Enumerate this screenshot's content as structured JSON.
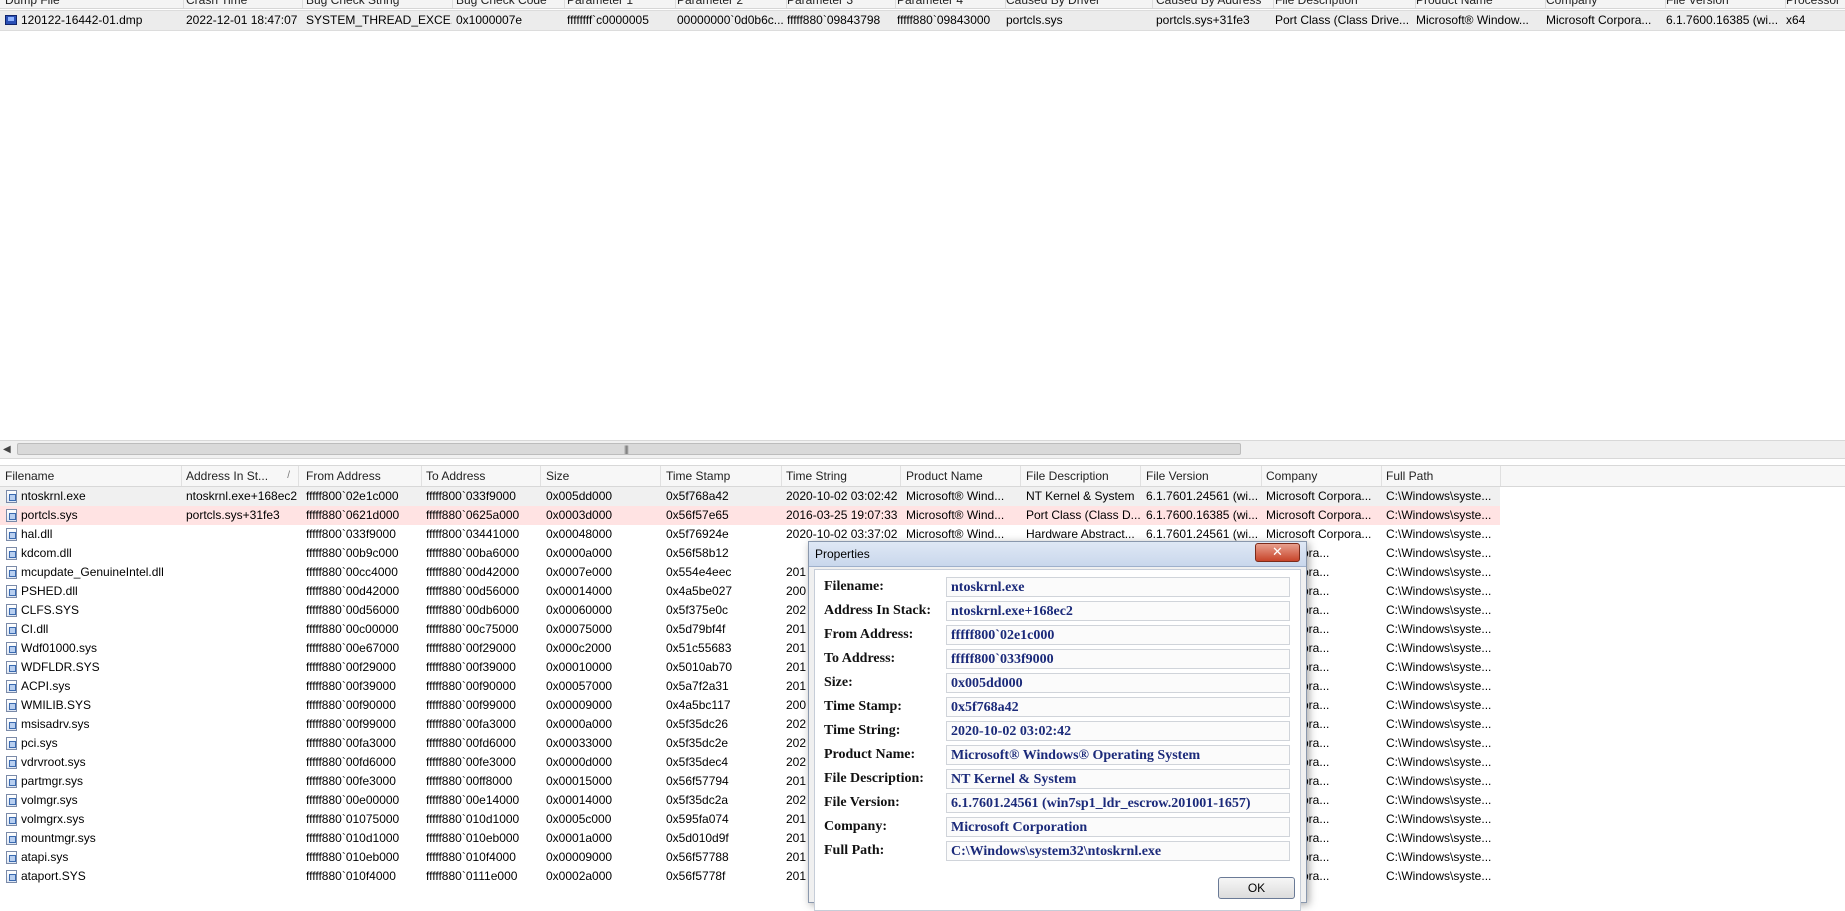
{
  "top_table": {
    "headers": [
      "Dump File",
      "Crash Time",
      "Bug Check String",
      "Bug Check Code",
      "Parameter 1",
      "Parameter 2",
      "Parameter 3",
      "Parameter 4",
      "Caused By Driver",
      "Caused By Address",
      "File Description",
      "Product Name",
      "Company",
      "File Version",
      "Processor"
    ],
    "row": [
      "120122-16442-01.dmp",
      "2022-12-01 18:47:07",
      "SYSTEM_THREAD_EXCE...",
      "0x1000007e",
      "ffffffff`c0000005",
      "00000000`0d0b6c...",
      "fffff880`09843798",
      "fffff880`09843000",
      "portcls.sys",
      "portcls.sys+31fe3",
      "Port Class (Class Drive...",
      "Microsoft® Window...",
      "Microsoft Corpora...",
      "6.1.7600.16385 (wi...",
      "x64"
    ]
  },
  "scrollbar": {
    "grip": "|||"
  },
  "lower_table": {
    "headers": [
      "Filename",
      "Address In St...",
      "From Address",
      "To Address",
      "Size",
      "Time Stamp",
      "Time String",
      "Product Name",
      "File Description",
      "File Version",
      "Company",
      "Full Path"
    ],
    "sort_indicator": "/",
    "rows": [
      [
        "ntoskrnl.exe",
        "ntoskrnl.exe+168ec2",
        "fffff800`02e1c000",
        "fffff800`033f9000",
        "0x005dd000",
        "0x5f768a42",
        "2020-10-02 03:02:42",
        "Microsoft® Wind...",
        "NT Kernel & System",
        "6.1.7601.24561 (wi...",
        "Microsoft Corpora...",
        "C:\\Windows\\syste..."
      ],
      [
        "portcls.sys",
        "portcls.sys+31fe3",
        "fffff880`0621d000",
        "fffff880`0625a000",
        "0x0003d000",
        "0x56f57e65",
        "2016-03-25 19:07:33",
        "Microsoft® Wind...",
        "Port Class (Class D...",
        "6.1.7600.16385 (wi...",
        "Microsoft Corpora...",
        "C:\\Windows\\syste..."
      ],
      [
        "hal.dll",
        "",
        "fffff800`033f9000",
        "fffff800`03441000",
        "0x00048000",
        "0x5f76924e",
        "2020-10-02 03:37:02",
        "Microsoft® Wind...",
        "Hardware Abstract...",
        "6.1.7601.24561 (wi...",
        "Microsoft Corpora...",
        "C:\\Windows\\syste..."
      ],
      [
        "kdcom.dll",
        "",
        "fffff880`00b9c000",
        "fffff880`00ba6000",
        "0x0000a000",
        "0x56f58b12",
        "",
        "",
        "",
        "",
        "ft Corpora...",
        "C:\\Windows\\syste..."
      ],
      [
        "mcupdate_GenuineIntel.dll",
        "",
        "fffff880`00cc4000",
        "fffff880`00d42000",
        "0x0007e000",
        "0x554e4eec",
        "201",
        "",
        "",
        "",
        "ft Corpora...",
        "C:\\Windows\\syste..."
      ],
      [
        "PSHED.dll",
        "",
        "fffff880`00d42000",
        "fffff880`00d56000",
        "0x00014000",
        "0x4a5be027",
        "200",
        "",
        "",
        "",
        "ft Corpora...",
        "C:\\Windows\\syste..."
      ],
      [
        "CLFS.SYS",
        "",
        "fffff880`00d56000",
        "fffff880`00db6000",
        "0x00060000",
        "0x5f375e0c",
        "202",
        "",
        "",
        "",
        "ft Corpora...",
        "C:\\Windows\\syste..."
      ],
      [
        "CI.dll",
        "",
        "fffff880`00c00000",
        "fffff880`00c75000",
        "0x00075000",
        "0x5d79bf4f",
        "201",
        "",
        "",
        "",
        "ft Corpora...",
        "C:\\Windows\\syste..."
      ],
      [
        "Wdf01000.sys",
        "",
        "fffff880`00e67000",
        "fffff880`00f29000",
        "0x000c2000",
        "0x51c55683",
        "201",
        "",
        "",
        "",
        "ft Corpora...",
        "C:\\Windows\\syste..."
      ],
      [
        "WDFLDR.SYS",
        "",
        "fffff880`00f29000",
        "fffff880`00f39000",
        "0x00010000",
        "0x5010ab70",
        "201",
        "",
        "",
        "",
        "ft Corpora...",
        "C:\\Windows\\syste..."
      ],
      [
        "ACPI.sys",
        "",
        "fffff880`00f39000",
        "fffff880`00f90000",
        "0x00057000",
        "0x5a7f2a31",
        "201",
        "",
        "",
        "",
        "ft Corpora...",
        "C:\\Windows\\syste..."
      ],
      [
        "WMILIB.SYS",
        "",
        "fffff880`00f90000",
        "fffff880`00f99000",
        "0x00009000",
        "0x4a5bc117",
        "200",
        "",
        "",
        "",
        "ft Corpora...",
        "C:\\Windows\\syste..."
      ],
      [
        "msisadrv.sys",
        "",
        "fffff880`00f99000",
        "fffff880`00fa3000",
        "0x0000a000",
        "0x5f35dc26",
        "202",
        "",
        "",
        "",
        "ft Corpora...",
        "C:\\Windows\\syste..."
      ],
      [
        "pci.sys",
        "",
        "fffff880`00fa3000",
        "fffff880`00fd6000",
        "0x00033000",
        "0x5f35dc2e",
        "202",
        "",
        "",
        "",
        "ft Corpora...",
        "C:\\Windows\\syste..."
      ],
      [
        "vdrvroot.sys",
        "",
        "fffff880`00fd6000",
        "fffff880`00fe3000",
        "0x0000d000",
        "0x5f35dec4",
        "202",
        "",
        "",
        "",
        "ft Corpora...",
        "C:\\Windows\\syste..."
      ],
      [
        "partmgr.sys",
        "",
        "fffff880`00fe3000",
        "fffff880`00ff8000",
        "0x00015000",
        "0x56f57794",
        "201",
        "",
        "",
        "",
        "ft Corpora...",
        "C:\\Windows\\syste..."
      ],
      [
        "volmgr.sys",
        "",
        "fffff880`00e00000",
        "fffff880`00e14000",
        "0x00014000",
        "0x5f35dc2a",
        "202",
        "",
        "",
        "",
        "ft Corpora...",
        "C:\\Windows\\syste..."
      ],
      [
        "volmgrx.sys",
        "",
        "fffff880`01075000",
        "fffff880`010d1000",
        "0x0005c000",
        "0x595fa074",
        "201",
        "",
        "",
        "",
        "ft Corpora...",
        "C:\\Windows\\syste..."
      ],
      [
        "mountmgr.sys",
        "",
        "fffff880`010d1000",
        "fffff880`010eb000",
        "0x0001a000",
        "0x5d010d9f",
        "201",
        "",
        "",
        "",
        "ft Corpora...",
        "C:\\Windows\\syste..."
      ],
      [
        "atapi.sys",
        "",
        "fffff880`010eb000",
        "fffff880`010f4000",
        "0x00009000",
        "0x56f57788",
        "201",
        "",
        "",
        "",
        "ft Corpora...",
        "C:\\Windows\\syste..."
      ],
      [
        "ataport.SYS",
        "",
        "fffff880`010f4000",
        "fffff880`0111e000",
        "0x0002a000",
        "0x56f5778f",
        "201",
        "",
        "",
        "",
        "ft Corpora...",
        "C:\\Windows\\syste..."
      ]
    ]
  },
  "dialog": {
    "title": "Properties",
    "close_glyph": "✕",
    "ok_label": "OK",
    "fields": [
      {
        "label": "Filename:",
        "value": "ntoskrnl.exe"
      },
      {
        "label": "Address In Stack:",
        "value": "ntoskrnl.exe+168ec2"
      },
      {
        "label": "From Address:",
        "value": "fffff800`02e1c000"
      },
      {
        "label": "To Address:",
        "value": "fffff800`033f9000"
      },
      {
        "label": "Size:",
        "value": "0x005dd000"
      },
      {
        "label": "Time Stamp:",
        "value": "0x5f768a42"
      },
      {
        "label": "Time String:",
        "value": "2020-10-02 03:02:42"
      },
      {
        "label": "Product Name:",
        "value": "Microsoft® Windows® Operating System"
      },
      {
        "label": "File Description:",
        "value": "NT Kernel & System"
      },
      {
        "label": "File Version:",
        "value": "6.1.7601.24561 (win7sp1_ldr_escrow.201001-1657)"
      },
      {
        "label": "Company:",
        "value": "Microsoft Corporation"
      },
      {
        "label": "Full Path:",
        "value": "C:\\Windows\\system32\\ntoskrnl.exe"
      }
    ]
  },
  "colors": {
    "selected_row": "#ececec",
    "highlight_row": "#ffe3e3",
    "dialog_value_text": "#1b2a7a",
    "close_button": "#c7442a"
  }
}
